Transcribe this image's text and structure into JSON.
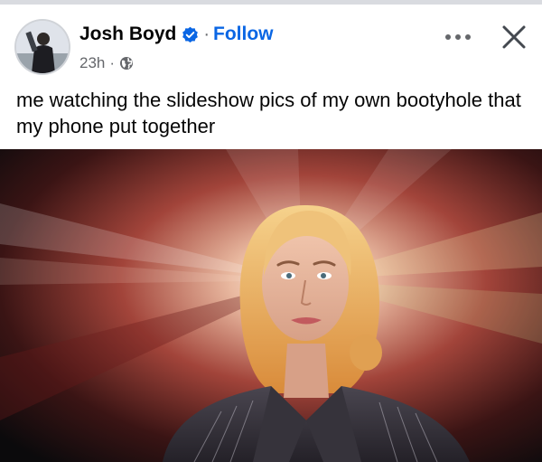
{
  "post": {
    "author_name": "Josh Boyd",
    "follow_label": "Follow",
    "dot_separator": "·",
    "timestamp": "23h",
    "meta_separator": "·",
    "caption": "me watching the slideshow pics of my own bootyhole that my phone put together"
  },
  "icons": {
    "verified": "verified-badge-icon",
    "audience": "globe-icon",
    "more": "more-options-icon",
    "close": "close-icon"
  },
  "colors": {
    "follow_accent": "#0a66e4",
    "secondary_text": "#65676b",
    "primary_text": "#050505"
  }
}
